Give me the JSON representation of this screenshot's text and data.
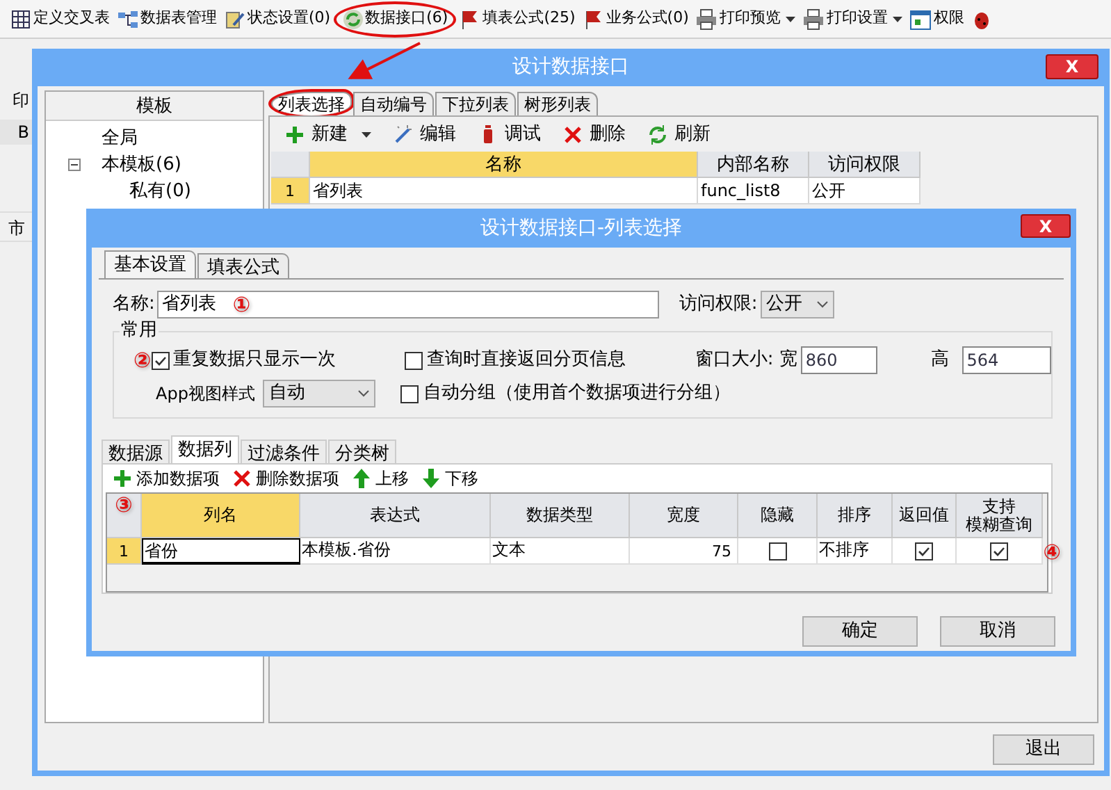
{
  "toolbar": {
    "items": [
      {
        "label": "定义交叉表",
        "kind": "grid",
        "dropdown": false,
        "circled": false
      },
      {
        "label": "数据表管理",
        "kind": "tables",
        "dropdown": false,
        "circled": false
      },
      {
        "label": "状态设置(0)",
        "kind": "pencil",
        "dropdown": false,
        "circled": false
      },
      {
        "label": "数据接口(6)",
        "kind": "sync",
        "dropdown": false,
        "circled": true
      },
      {
        "label": "填表公式(25)",
        "kind": "flag",
        "dropdown": false,
        "circled": false
      },
      {
        "label": "业务公式(0)",
        "kind": "flag",
        "dropdown": false,
        "circled": false
      },
      {
        "label": "打印预览",
        "kind": "printer",
        "dropdown": true,
        "circled": false
      },
      {
        "label": "打印设置",
        "kind": "printer",
        "dropdown": true,
        "circled": false
      },
      {
        "label": "权限",
        "kind": "calendar",
        "dropdown": false,
        "circled": false
      },
      {
        "kind": "bug",
        "dropdown": false,
        "circled": false
      }
    ]
  },
  "background": {
    "top_label": "印",
    "header_label": "B",
    "row_label": "市"
  },
  "outer_dialog": {
    "title": "设计数据接口",
    "close": "X",
    "left_panel": {
      "header": "模板",
      "tree": [
        {
          "label": "全局"
        },
        {
          "label": "本模板(6)",
          "expanded": true,
          "children": [
            {
              "label": "私有(0)"
            }
          ]
        }
      ]
    },
    "tabs": [
      {
        "label": "列表选择",
        "selected": true,
        "circled": true
      },
      {
        "label": "自动编号",
        "selected": false,
        "circled": false
      },
      {
        "label": "下拉列表",
        "selected": false,
        "circled": false
      },
      {
        "label": "树形列表",
        "selected": false,
        "circled": false
      }
    ],
    "actions": [
      {
        "label": "新建",
        "kind": "add",
        "dropdown": true
      },
      {
        "label": "编辑",
        "kind": "edit",
        "dropdown": false
      },
      {
        "label": "调试",
        "kind": "debug",
        "dropdown": false
      },
      {
        "label": "删除",
        "kind": "delete",
        "dropdown": false
      },
      {
        "label": "刷新",
        "kind": "refresh",
        "dropdown": false
      }
    ],
    "table": {
      "columns": [
        {
          "label": "名称",
          "selected": true
        },
        {
          "label": "内部名称",
          "selected": false
        },
        {
          "label": "访问权限",
          "selected": false
        }
      ],
      "rows": [
        {
          "number": "1",
          "selected": true,
          "cells": [
            "省列表",
            "func_list8",
            "公开"
          ]
        }
      ]
    },
    "exit_button": "退出"
  },
  "inner_dialog": {
    "title": "设计数据接口-列表选择",
    "close": "X",
    "tabs": [
      {
        "label": "基本设置",
        "selected": true
      },
      {
        "label": "填表公式",
        "selected": false
      }
    ],
    "name_label": "名称:",
    "name_value": "省列表",
    "name_marker": "①",
    "access_label": "访问权限:",
    "access_value": "公开",
    "group_title": "常用",
    "repeat_marker": "②",
    "repeat": {
      "label": "重复数据只显示一次",
      "checked": true
    },
    "paging": {
      "label": "查询时直接返回分页信息",
      "checked": false
    },
    "size_label": "窗口大小: 宽",
    "width_value": "860",
    "height_label": "高",
    "height_value": "564",
    "view_label": "App视图样式",
    "view_value": "自动",
    "autogroup": {
      "label": "自动分组（使用首个数据项进行分组）",
      "checked": false
    },
    "sub_tabs": [
      {
        "label": "数据源",
        "selected": false
      },
      {
        "label": "数据列",
        "selected": true
      },
      {
        "label": "过滤条件",
        "selected": false
      },
      {
        "label": "分类树",
        "selected": false
      }
    ],
    "sub_actions": [
      {
        "label": "添加数据项",
        "kind": "add"
      },
      {
        "label": "删除数据项",
        "kind": "delete"
      },
      {
        "label": "上移",
        "kind": "up"
      },
      {
        "label": "下移",
        "kind": "down"
      }
    ],
    "grid_marker": "③",
    "row_marker": "④",
    "grid": {
      "columns": [
        {
          "label": "列名",
          "kind": "text",
          "selected": true
        },
        {
          "label": "表达式",
          "kind": "text",
          "selected": false
        },
        {
          "label": "数据类型",
          "kind": "text",
          "selected": false
        },
        {
          "label": "宽度",
          "kind": "number",
          "selected": false
        },
        {
          "label": "隐藏",
          "kind": "checkbox",
          "selected": false
        },
        {
          "label": "排序",
          "kind": "text",
          "selected": false
        },
        {
          "label": "返回值",
          "kind": "checkbox",
          "selected": false
        },
        {
          "label_lines": [
            "支持",
            "模糊查询"
          ],
          "kind": "checkbox",
          "selected": false
        }
      ],
      "rows": [
        {
          "number": "1",
          "selected": true,
          "cells": [
            "省份",
            "本模板.省份",
            "文本",
            "75",
            false,
            "不排序",
            true,
            true
          ]
        }
      ]
    },
    "ok_button": "确定",
    "cancel_button": "取消"
  }
}
